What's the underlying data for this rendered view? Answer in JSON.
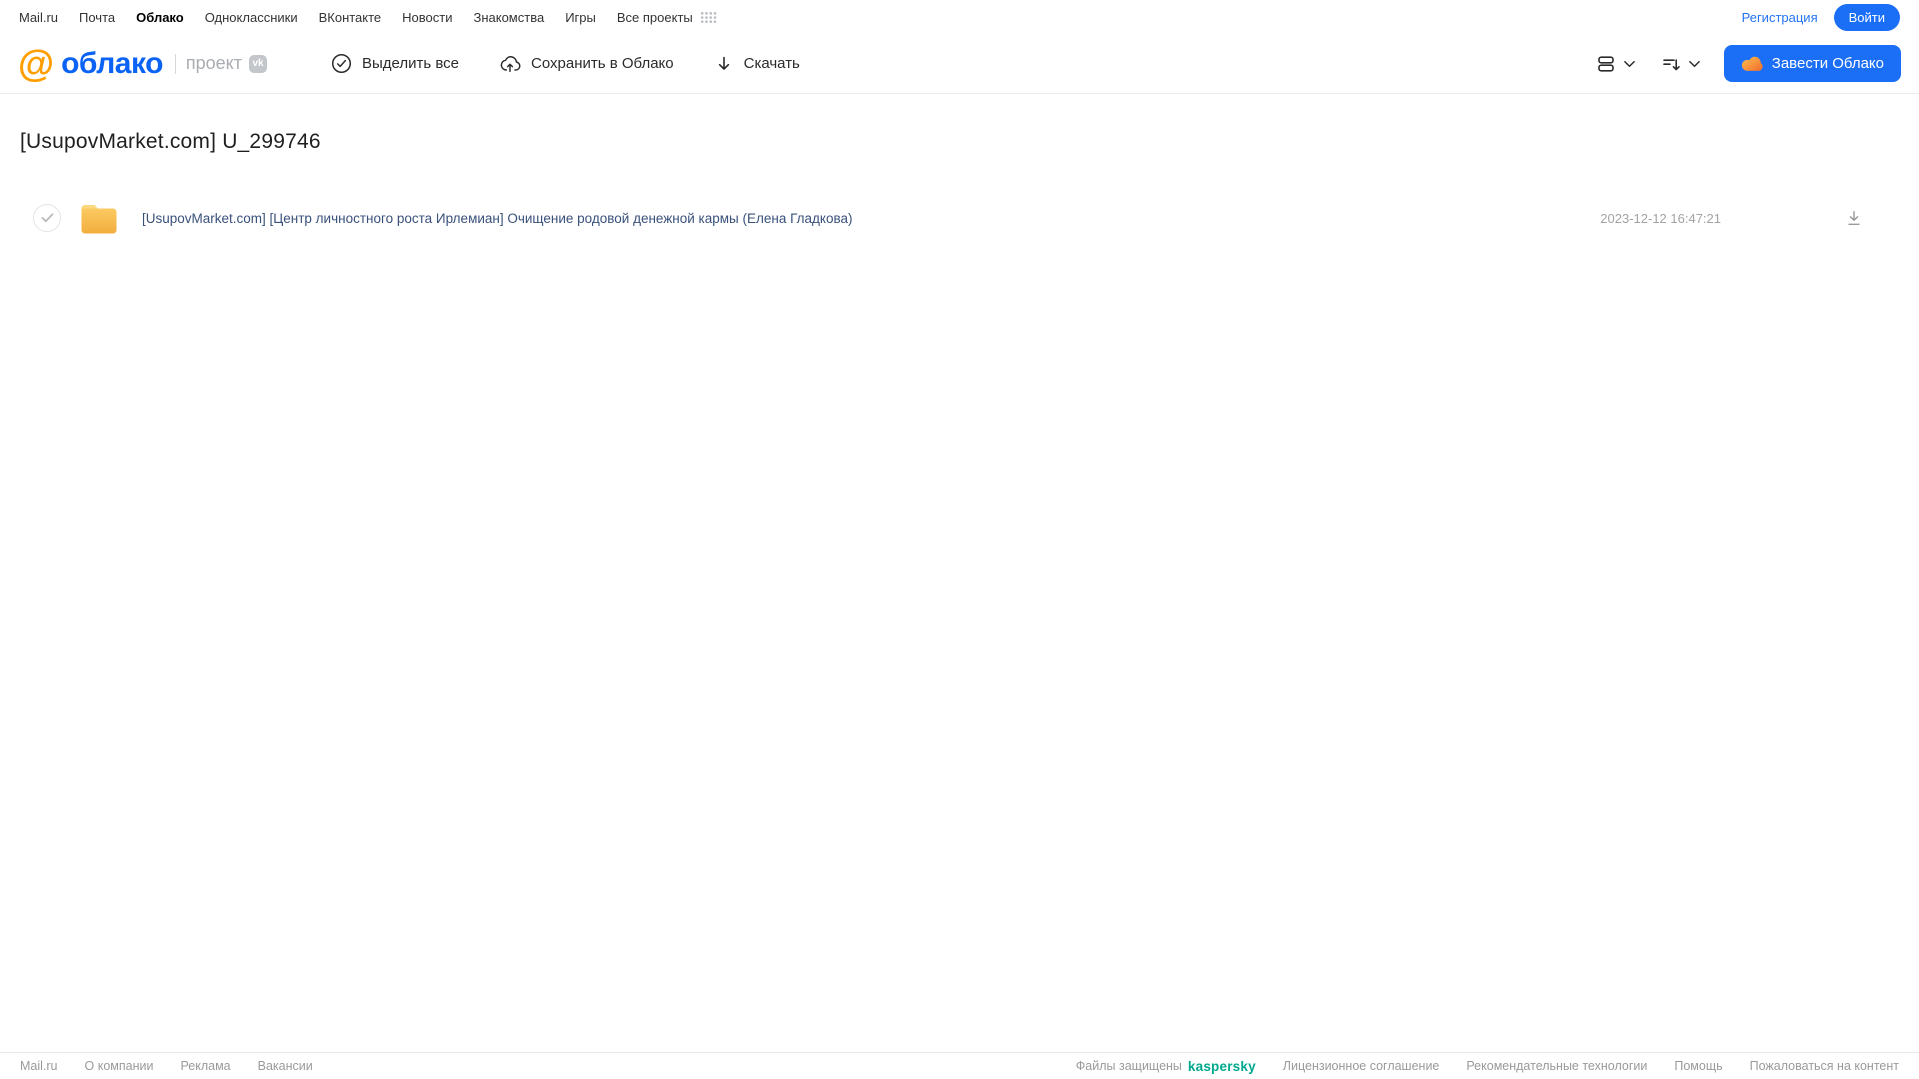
{
  "top_nav": {
    "links": [
      {
        "label": "Mail.ru",
        "active": false
      },
      {
        "label": "Почта",
        "active": false
      },
      {
        "label": "Облако",
        "active": true
      },
      {
        "label": "Одноклассники",
        "active": false
      },
      {
        "label": "ВКонтакте",
        "active": false
      },
      {
        "label": "Новости",
        "active": false
      },
      {
        "label": "Знакомства",
        "active": false
      },
      {
        "label": "Игры",
        "active": false
      },
      {
        "label": "Все проекты",
        "active": false
      }
    ],
    "registration_label": "Регистрация",
    "login_label": "Войти"
  },
  "header": {
    "logo_at": "@",
    "logo_text": "облако",
    "project_label": "проект",
    "vk_badge": "vk",
    "actions": {
      "select_all": "Выделить все",
      "save_to_cloud": "Сохранить в Облако",
      "download": "Скачать"
    },
    "get_cloud_button": "Завести Облако"
  },
  "main": {
    "title": "[UsupovMarket.com] U_299746",
    "files": [
      {
        "type": "folder",
        "name": "[UsupovMarket.com] [Центр личностного роста Ирлемиан] Очищение родовой денежной кармы (Елена Гладкова)",
        "date": "2023-12-12 16:47:21"
      }
    ]
  },
  "footer": {
    "left_links": [
      "Mail.ru",
      "О компании",
      "Реклама",
      "Вакансии"
    ],
    "protected_text": "Файлы защищены",
    "kaspersky_label": "kaspersky",
    "right_links": [
      "Лицензионное соглашение",
      "Рекомендательные технологии",
      "Помощь",
      "Пожаловаться на контент"
    ]
  },
  "icons": {
    "grid": "apps-grid-icon",
    "check_circle": "check-circle-icon",
    "cloud_up": "cloud-upload-icon",
    "download": "download-icon",
    "view": "view-mode-icon",
    "sort": "sort-icon",
    "chevron": "chevron-down-icon",
    "cloud": "cloud-icon",
    "folder": "folder-icon"
  },
  "colors": {
    "accent_blue": "#1b6ef6",
    "logo_blue": "#0b63f6",
    "logo_orange": "#ff9e00",
    "folder_yellow": "#f3ad3e",
    "kaspersky_green": "#00a88e",
    "file_link": "#39517b"
  }
}
